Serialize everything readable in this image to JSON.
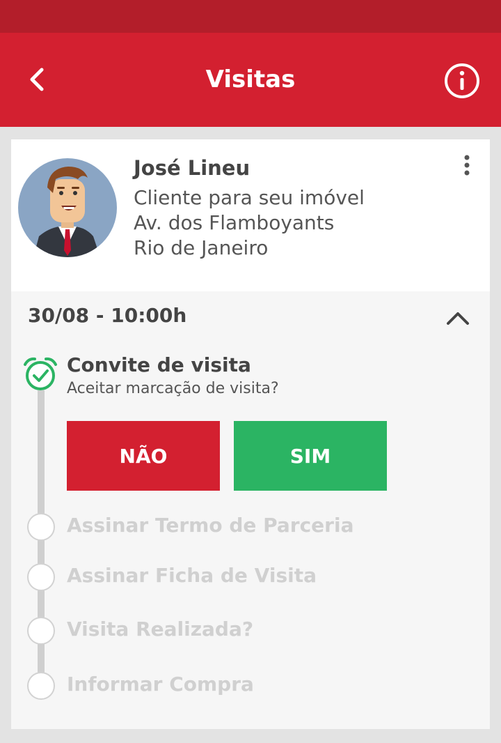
{
  "app": {
    "title": "Visitas"
  },
  "client": {
    "name": "José Lineu",
    "lines": [
      "Cliente para seu imóvel",
      "Av. dos Flamboyants",
      "Rio de Janeiro"
    ]
  },
  "visit": {
    "datetime": "30/08 - 10:00h",
    "current_step": {
      "title": "Convite de visita",
      "subtitle": "Aceitar marcação de visita?",
      "no_label": "NÃO",
      "yes_label": "SIM"
    },
    "pending_steps": [
      "Assinar Termo de Parceria",
      "Assinar Ficha de Visita",
      "Visita Realizada?",
      "Informar Compra"
    ]
  },
  "colors": {
    "primary": "#d32030",
    "status_bar": "#b31e2a",
    "success": "#2bb463",
    "inactive": "#d0d0d0"
  },
  "icons": {
    "back": "chevron-left-icon",
    "info": "info-circle-icon",
    "menu": "kebab-menu-icon",
    "collapse": "chevron-up-icon",
    "done": "alarm-check-icon"
  }
}
